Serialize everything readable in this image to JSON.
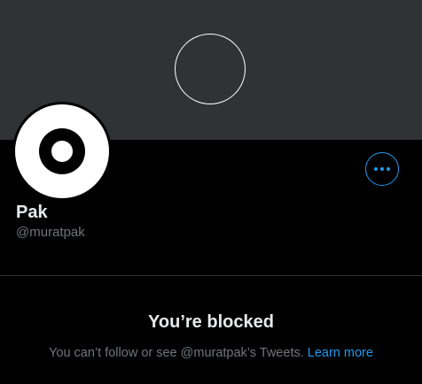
{
  "profile": {
    "display_name": "Pak",
    "handle": "@muratpak",
    "banner_icon": "circle-outline-icon",
    "avatar_icon": "target-icon",
    "more_button_icon": "more-dots-icon"
  },
  "blocked": {
    "title": "You’re blocked",
    "message": "You can’t follow or see @muratpak’s Tweets.",
    "link_label": "Learn more"
  },
  "colors": {
    "background": "#000000",
    "banner": "#2f3336",
    "accent": "#1d9bf0",
    "primary_text": "#e7e9ea",
    "secondary_text": "#71767b"
  }
}
